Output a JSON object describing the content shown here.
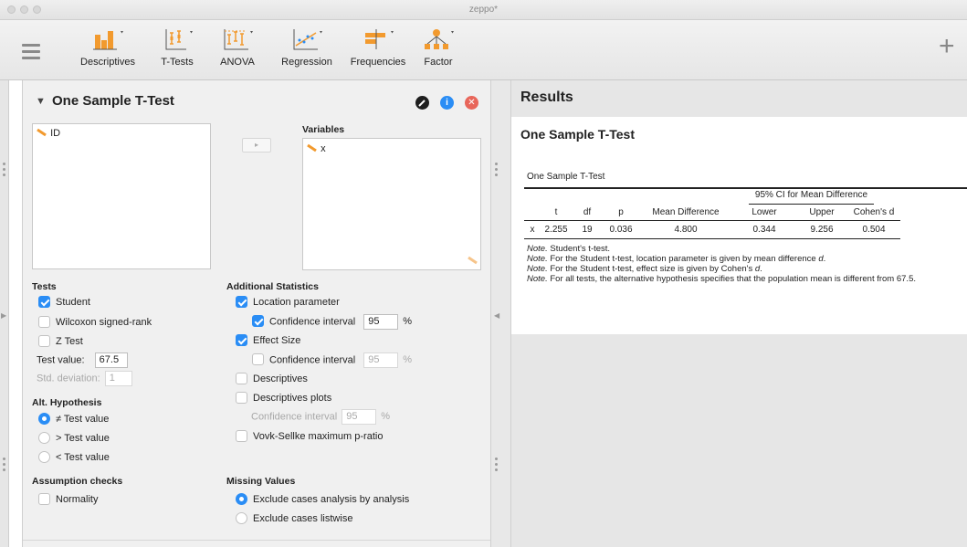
{
  "window": {
    "title": "zeppo*"
  },
  "toolbar": {
    "items": [
      {
        "label": "Descriptives",
        "icon": "descriptives-icon"
      },
      {
        "label": "T-Tests",
        "icon": "t-tests-icon"
      },
      {
        "label": "ANOVA",
        "icon": "anova-icon"
      },
      {
        "label": "Regression",
        "icon": "regression-icon"
      },
      {
        "label": "Frequencies",
        "icon": "frequencies-icon"
      },
      {
        "label": "Factor",
        "icon": "factor-icon"
      }
    ],
    "add_label": "+"
  },
  "analysis": {
    "title": "One Sample T-Test",
    "source_vars": [
      "ID"
    ],
    "variables_label": "Variables",
    "variables": [
      "x"
    ],
    "move_arrow": "▸",
    "tests": {
      "heading": "Tests",
      "student": "Student",
      "wilcoxon": "Wilcoxon signed-rank",
      "ztest": "Z Test",
      "test_value_label": "Test value:",
      "test_value": "67.5",
      "std_dev_label": "Std. deviation:",
      "std_dev_value": "1"
    },
    "alt": {
      "heading": "Alt. Hypothesis",
      "neq": "≠ Test value",
      "gt": "> Test value",
      "lt": "< Test value"
    },
    "assumption": {
      "heading": "Assumption checks",
      "normality": "Normality"
    },
    "additional": {
      "heading": "Additional Statistics",
      "location": "Location parameter",
      "ci_label": "Confidence interval",
      "ci_value": "95",
      "pct": "%",
      "effect_size": "Effect Size",
      "es_ci_label": "Confidence interval",
      "es_ci_value": "95",
      "descriptives": "Descriptives",
      "desc_plots": "Descriptives plots",
      "dp_ci_label": "Confidence interval",
      "dp_ci_value": "95",
      "vovk": "Vovk-Sellke maximum p-ratio"
    },
    "missing": {
      "heading": "Missing Values",
      "by_analysis": "Exclude cases analysis by analysis",
      "listwise": "Exclude cases listwise"
    }
  },
  "results": {
    "heading": "Results",
    "analysis_title": "One Sample T-Test",
    "table_title": "One Sample T-Test",
    "ci_header": "95% CI for Mean Difference",
    "columns": [
      "",
      "t",
      "df",
      "p",
      "Mean Difference",
      "Lower",
      "Upper",
      "Cohen's d"
    ],
    "row": [
      "x",
      "2.255",
      "19",
      "0.036",
      "4.800",
      "0.344",
      "9.256",
      "0.504"
    ],
    "notes": [
      {
        "label": "Note.",
        "text": " Student's t-test."
      },
      {
        "label": "Note.",
        "text": " For the Student t-test, location parameter is given by mean difference ",
        "em": "d",
        "end": "."
      },
      {
        "label": "Note.",
        "text": " For the Student t-test, effect size is given by Cohen's ",
        "em": "d",
        "end": "."
      },
      {
        "label": "Note.",
        "text": " For all tests, the alternative hypothesis specifies that the population mean is different from 67.5."
      }
    ]
  },
  "colors": {
    "accent": "#2a8df5",
    "close": "#e8665a",
    "info": "#2a8df5",
    "toolbar_orange": "#f29a2e"
  }
}
